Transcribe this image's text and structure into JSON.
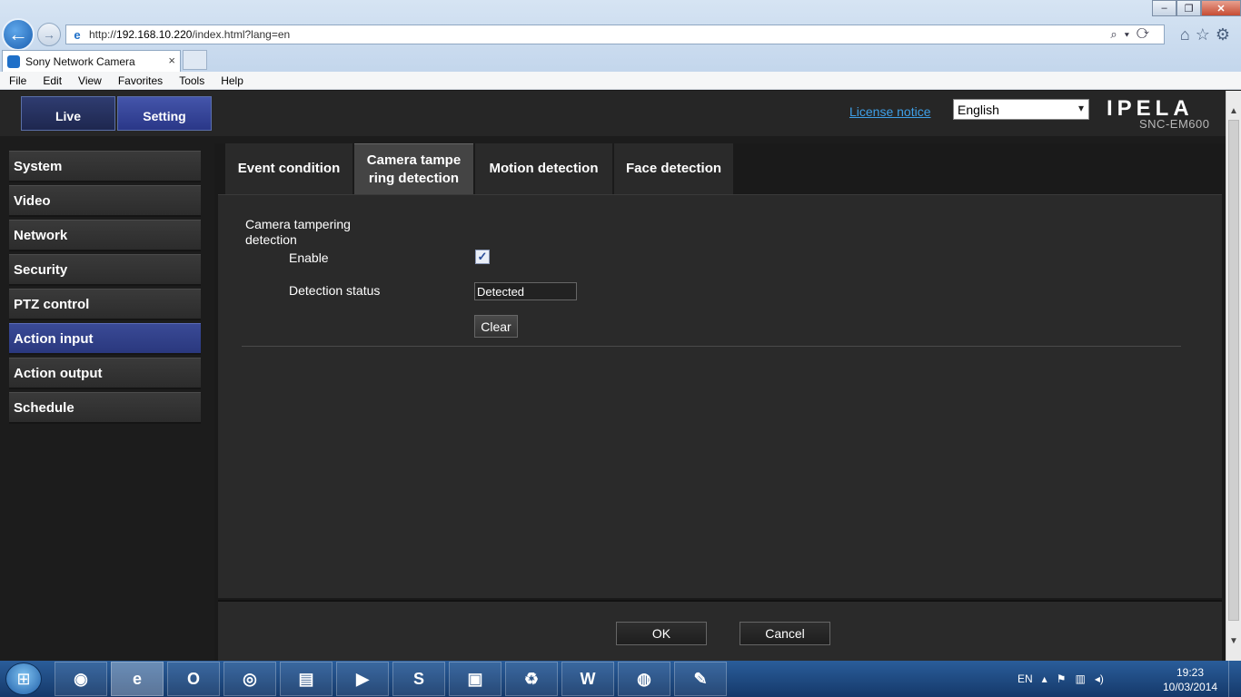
{
  "browser": {
    "url_prefix": "http://",
    "url_host": "192.168.10.220",
    "url_path": "/index.html?lang=en",
    "tab_title": "Sony Network Camera",
    "tab_close": "×",
    "menu": [
      "File",
      "Edit",
      "View",
      "Favorites",
      "Tools",
      "Help"
    ]
  },
  "header": {
    "tabs": {
      "live": "Live",
      "setting": "Setting"
    },
    "license_link": "License notice",
    "language": "English",
    "brand": "IPELA",
    "model": "SNC-EM600"
  },
  "sidebar": {
    "items": [
      {
        "label": "System"
      },
      {
        "label": "Video"
      },
      {
        "label": "Network"
      },
      {
        "label": "Security"
      },
      {
        "label": "PTZ control"
      },
      {
        "label": "Action input"
      },
      {
        "label": "Action output"
      },
      {
        "label": "Schedule"
      }
    ],
    "active": "Action input"
  },
  "content": {
    "tabs": [
      {
        "label": "Event condition"
      },
      {
        "label": "Camera tampe ring detection"
      },
      {
        "label": "Motion detection"
      },
      {
        "label": "Face detection"
      }
    ],
    "active_tab": "Camera tampe ring detection",
    "section_title": "Camera tampering detection",
    "enable_label": "Enable",
    "enable_checked": true,
    "status_label": "Detection status",
    "status_value": "Detected",
    "clear_label": "Clear"
  },
  "footer": {
    "ok_label": "OK",
    "cancel_label": "Cancel"
  },
  "taskbar": {
    "language": "EN",
    "time": "19:23",
    "date": "10/03/2014",
    "apps": [
      "firefox-icon",
      "ie-icon",
      "outlook-icon",
      "chrome-icon",
      "explorer-icon",
      "media-icon",
      "skype-icon",
      "monitor-icon",
      "recycle-icon",
      "word-icon",
      "camera-app-icon",
      "paint-icon"
    ]
  },
  "colors": {
    "accent": "#2a387e",
    "link": "#3fa0e8",
    "page_bg": "#1c1c1c",
    "panel_bg": "#2a2a2a"
  }
}
